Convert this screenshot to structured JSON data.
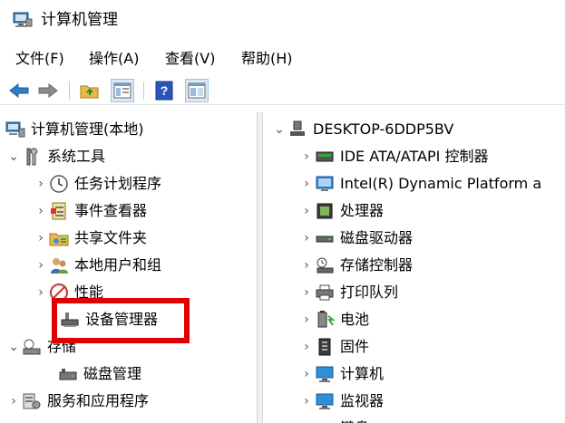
{
  "window": {
    "title": "计算机管理"
  },
  "menu": [
    {
      "label": "文件(F)"
    },
    {
      "label": "操作(A)"
    },
    {
      "label": "查看(V)"
    },
    {
      "label": "帮助(H)"
    }
  ],
  "toolbar": {
    "buttons": [
      "back-icon",
      "forward-icon",
      "up-folder-icon",
      "show-hide-tree-icon",
      "help-icon",
      "properties-icon"
    ]
  },
  "left_tree": [
    {
      "label": "计算机管理(本地)",
      "icon": "computer-management-icon"
    },
    {
      "label": "系统工具",
      "icon": "tools-icon",
      "expanded": true
    },
    {
      "label": "任务计划程序",
      "icon": "clock-icon"
    },
    {
      "label": "事件查看器",
      "icon": "event-viewer-icon"
    },
    {
      "label": "共享文件夹",
      "icon": "shared-folder-icon"
    },
    {
      "label": "本地用户和组",
      "icon": "users-icon"
    },
    {
      "label": "性能",
      "icon": "performance-icon"
    },
    {
      "label": "设备管理器",
      "icon": "device-manager-icon",
      "selected": true
    },
    {
      "label": "存储",
      "icon": "storage-icon",
      "expanded": true
    },
    {
      "label": "磁盘管理",
      "icon": "disk-management-icon"
    },
    {
      "label": "服务和应用程序",
      "icon": "services-icon"
    }
  ],
  "right_tree": [
    {
      "label": "DESKTOP-6DDP5BV",
      "icon": "computer-icon",
      "expanded": true
    },
    {
      "label": "IDE ATA/ATAPI 控制器",
      "icon": "ide-controller-icon"
    },
    {
      "label": "Intel(R) Dynamic Platform a",
      "icon": "intel-platform-icon"
    },
    {
      "label": "处理器",
      "icon": "processor-icon"
    },
    {
      "label": "磁盘驱动器",
      "icon": "disk-drive-icon"
    },
    {
      "label": "存储控制器",
      "icon": "storage-controller-icon"
    },
    {
      "label": "打印队列",
      "icon": "printer-icon"
    },
    {
      "label": "电池",
      "icon": "battery-icon"
    },
    {
      "label": "固件",
      "icon": "firmware-icon"
    },
    {
      "label": "计算机",
      "icon": "monitor-icon"
    },
    {
      "label": "监视器",
      "icon": "monitor-icon"
    },
    {
      "label": "键盘",
      "icon": "keyboard-icon"
    }
  ],
  "colors": {
    "highlight": "#e00000",
    "selection": "#cce8ff",
    "accent": "#3c7fb1"
  }
}
